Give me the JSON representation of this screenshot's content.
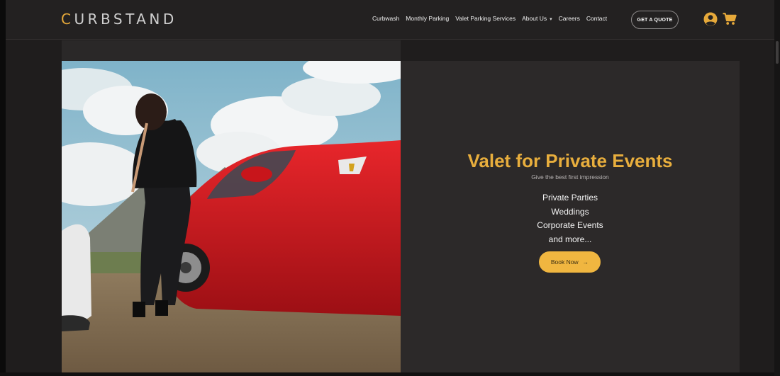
{
  "brand": {
    "logo_prefix": "C",
    "logo_mid": "URB",
    "logo_suffix": "STAND",
    "accent_color": "#e6a93a"
  },
  "nav": {
    "items": [
      {
        "label": "Curbwash"
      },
      {
        "label": "Monthly Parking"
      },
      {
        "label": "Valet Parking Services"
      },
      {
        "label": "About Us",
        "has_dropdown": true,
        "caret": "▾"
      },
      {
        "label": "Careers"
      },
      {
        "label": "Contact"
      }
    ],
    "quote_button": "GET A QUOTE",
    "user_icon": "user-circle-icon",
    "cart_icon": "cart-icon"
  },
  "hero": {
    "title": "Valet for Private Events",
    "subtitle": "Give the best first impression",
    "list": [
      "Private Parties",
      "Weddings",
      "Corporate Events",
      "and more..."
    ],
    "cta_label": "Book Now",
    "cta_arrow": "→",
    "colors": {
      "panel_bg": "#2c2929",
      "title": "#e8ae3d",
      "cta_bg": "#f0b640"
    }
  }
}
